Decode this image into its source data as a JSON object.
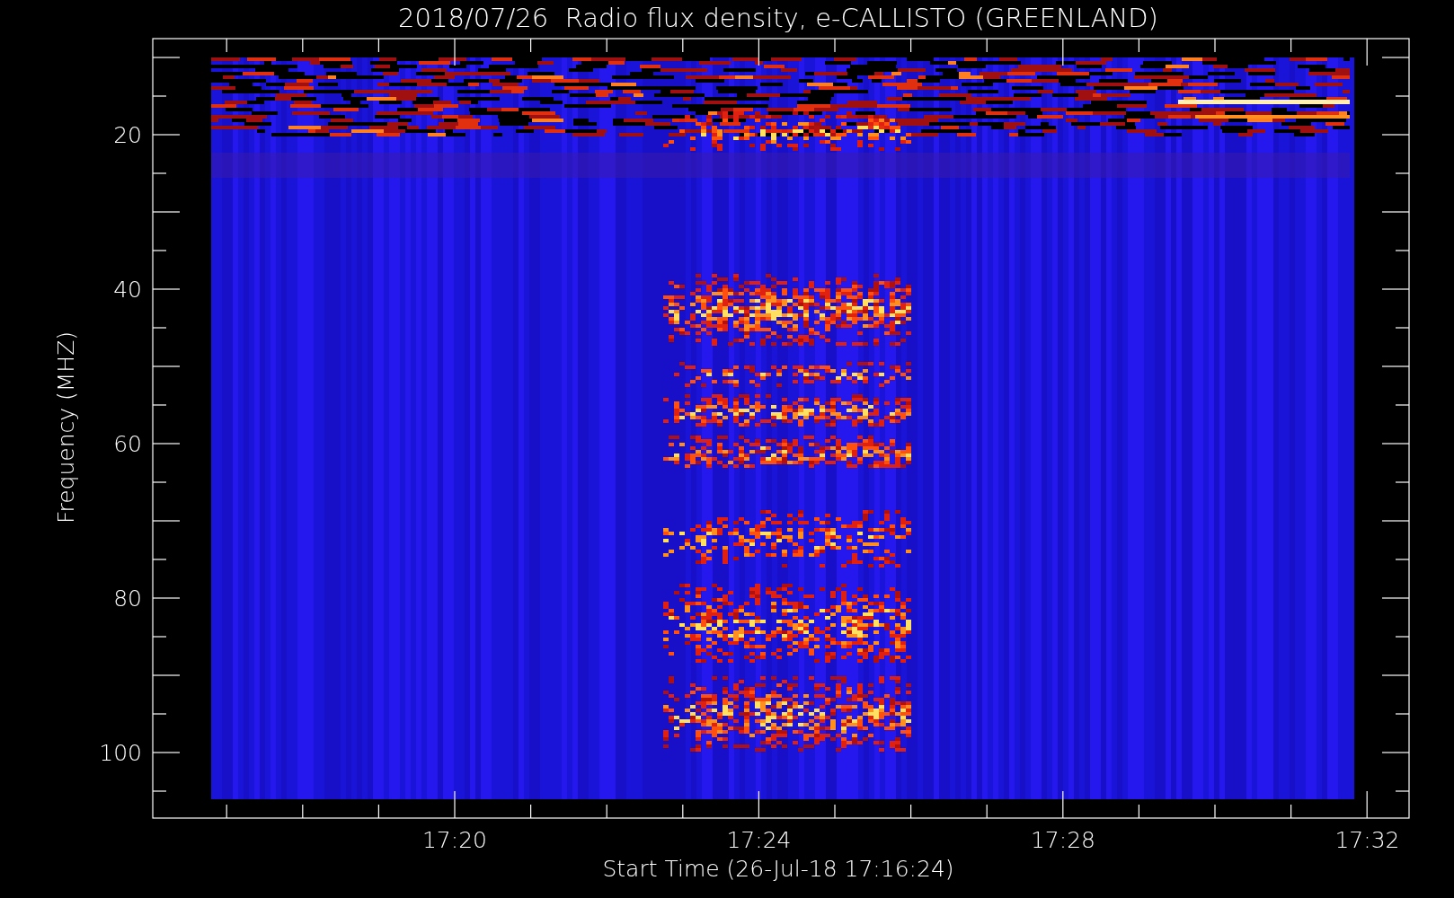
{
  "title": "2018/07/26  Radio flux density, e-CALLISTO (GREENLAND)",
  "plot": {
    "ylabel": "Frequency (MHZ)",
    "xlabel": "Start Time (26-Jul-18 17:16:24)",
    "yticks": [
      "20",
      "40",
      "60",
      "80",
      "100"
    ],
    "xticks": [
      "17:20",
      "17:24",
      "17:28",
      "17:32"
    ]
  }
}
